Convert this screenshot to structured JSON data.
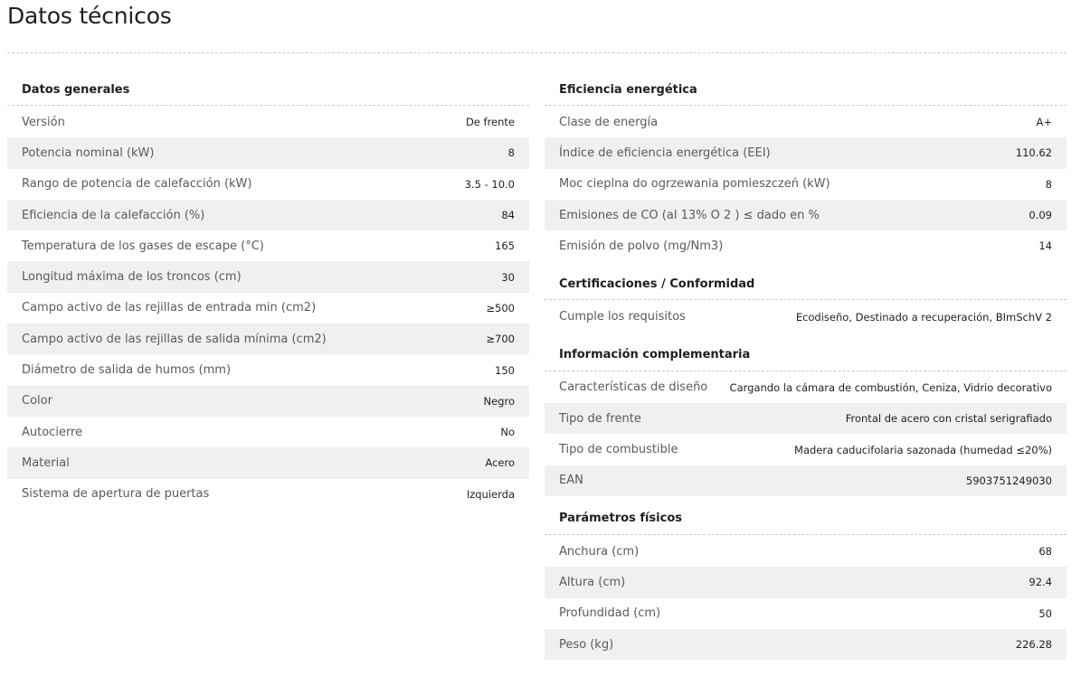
{
  "page": {
    "title": "Datos técnicos"
  },
  "left": {
    "sections": [
      {
        "title": "Datos generales",
        "rows": [
          {
            "label": "Versión",
            "value": "De frente"
          },
          {
            "label": "Potencia nominal (kW)",
            "value": "8"
          },
          {
            "label": "Rango de potencia de calefacción (kW)",
            "value": "3.5 - 10.0"
          },
          {
            "label": "Eficiencia de la calefacción (%)",
            "value": "84"
          },
          {
            "label": "Temperatura de los gases de escape (°C)",
            "value": "165"
          },
          {
            "label": "Longitud máxima de los troncos (cm)",
            "value": "30"
          },
          {
            "label": "Campo activo de las rejillas de entrada min (cm2)",
            "value": "≥500"
          },
          {
            "label": "Campo activo de las rejillas de salida mínima (cm2)",
            "value": "≥700"
          },
          {
            "label": "Diámetro de salida de humos (mm)",
            "value": "150"
          },
          {
            "label": "Color",
            "value": "Negro"
          },
          {
            "label": "Autocierre",
            "value": "No"
          },
          {
            "label": "Material",
            "value": "Acero"
          },
          {
            "label": "Sistema de apertura de puertas",
            "value": "Izquierda"
          }
        ]
      }
    ]
  },
  "right": {
    "sections": [
      {
        "title": "Eficiencia energética",
        "rows": [
          {
            "label": "Clase de energía",
            "value": "A+"
          },
          {
            "label": "Índice de eficiencia energética (EEI)",
            "value": "110.62"
          },
          {
            "label": "Moc cieplna do ogrzewania pomieszczeń (kW)",
            "value": "8"
          },
          {
            "label": "Emisiones de CO (al 13% O 2 ) ≤ dado en %",
            "value": "0.09"
          },
          {
            "label": "Emisión de polvo (mg/Nm3)",
            "value": "14"
          }
        ]
      },
      {
        "title": "Certificaciones / Conformidad",
        "rows": [
          {
            "label": "Cumple los requisitos",
            "value": "Ecodiseño, Destinado a recuperación, BImSchV 2"
          }
        ]
      },
      {
        "title": "Información complementaria",
        "rows": [
          {
            "label": "Características de diseño",
            "value": "Cargando la cámara de combustión, Ceniza, Vidrio decorativo"
          },
          {
            "label": "Tipo de frente",
            "value": "Frontal de acero con cristal serigrafiado"
          },
          {
            "label": "Tipo de combustible",
            "value": "Madera caducifolaria sazonada (humedad ≤20%)"
          },
          {
            "label": "EAN",
            "value": "5903751249030"
          }
        ]
      },
      {
        "title": "Parámetros físicos",
        "rows": [
          {
            "label": "Anchura (cm)",
            "value": "68"
          },
          {
            "label": "Altura (cm)",
            "value": "92.4"
          },
          {
            "label": "Profundidad (cm)",
            "value": "50"
          },
          {
            "label": "Peso (kg)",
            "value": "226.28"
          }
        ]
      }
    ]
  }
}
